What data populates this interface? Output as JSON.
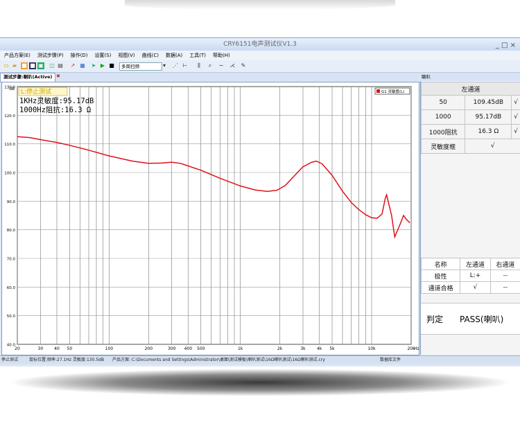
{
  "window": {
    "title": "CRY6151电声测试仪V1.3",
    "controls": "_ □ ×"
  },
  "menu": [
    "产品方案(E)",
    "测试步骤(P)",
    "操作(D)",
    "设置(S)",
    "视图(V)",
    "曲线(C)",
    "数据(A)",
    "工具(T)",
    "帮助(H)"
  ],
  "toolbar": {
    "select_value": "多周扫频"
  },
  "tab": {
    "label": "测试步骤:喇叭(Active)"
  },
  "chart": {
    "status_label": "L:停止测试",
    "sensitivity_text": "1KHz灵敏度:95.17dB",
    "impedance_text": "1000Hz阻抗:16.3 Ω",
    "legend_label": "G1 灵敏度(L)",
    "line_color": "#e0101a",
    "y_unit": "dB",
    "x_unit": "Hz"
  },
  "chart_data": {
    "type": "line",
    "x_scale": "log",
    "xlim": [
      20,
      20000
    ],
    "ylim": [
      40,
      130
    ],
    "y_ticks": [
      "130.0",
      "120.0",
      "110.0",
      "100.0",
      "90.0",
      "80.0",
      "70.0",
      "60.0",
      "50.0",
      "40.0"
    ],
    "x_ticks": [
      {
        "v": 20,
        "label": "20"
      },
      {
        "v": 30,
        "label": "30"
      },
      {
        "v": 40,
        "label": "40"
      },
      {
        "v": 50,
        "label": "50"
      },
      {
        "v": 100,
        "label": "100"
      },
      {
        "v": 200,
        "label": "200"
      },
      {
        "v": 300,
        "label": "300"
      },
      {
        "v": 400,
        "label": "400"
      },
      {
        "v": 500,
        "label": "500"
      },
      {
        "v": 1000,
        "label": "1k"
      },
      {
        "v": 2000,
        "label": "2k"
      },
      {
        "v": 3000,
        "label": "3k"
      },
      {
        "v": 4000,
        "label": "4k"
      },
      {
        "v": 5000,
        "label": "5k"
      },
      {
        "v": 10000,
        "label": "10k"
      },
      {
        "v": 20000,
        "label": "20k"
      }
    ],
    "series": [
      {
        "name": "G1 灵敏度(L)",
        "points": [
          [
            20,
            112.5
          ],
          [
            25,
            112.2
          ],
          [
            30,
            111.5
          ],
          [
            40,
            110.5
          ],
          [
            50,
            109.5
          ],
          [
            70,
            107.8
          ],
          [
            100,
            105.8
          ],
          [
            150,
            104
          ],
          [
            200,
            103.2
          ],
          [
            250,
            103.3
          ],
          [
            300,
            103.6
          ],
          [
            350,
            103.2
          ],
          [
            400,
            102.3
          ],
          [
            500,
            100.8
          ],
          [
            700,
            98
          ],
          [
            1000,
            95.3
          ],
          [
            1300,
            93.9
          ],
          [
            1600,
            93.4
          ],
          [
            1900,
            93.8
          ],
          [
            2200,
            95.5
          ],
          [
            2600,
            99
          ],
          [
            3000,
            102
          ],
          [
            3500,
            103.6
          ],
          [
            3800,
            104
          ],
          [
            4200,
            103
          ],
          [
            5000,
            99
          ],
          [
            6000,
            93.5
          ],
          [
            7000,
            89.5
          ],
          [
            8000,
            87
          ],
          [
            9000,
            85.3
          ],
          [
            10000,
            84.2
          ],
          [
            11000,
            84
          ],
          [
            12000,
            85.5
          ],
          [
            12700,
            91
          ],
          [
            13000,
            92.2
          ],
          [
            14200,
            85
          ],
          [
            15000,
            77.5
          ],
          [
            16500,
            82
          ],
          [
            17500,
            85
          ],
          [
            18500,
            83.5
          ],
          [
            19500,
            82.5
          ]
        ]
      }
    ]
  },
  "right_panel": {
    "header": "喇叭",
    "top_table": {
      "header": "左通道",
      "rows": [
        {
          "name": "50",
          "value": "109.45dB",
          "check": "√"
        },
        {
          "name": "1000",
          "value": "95.17dB",
          "check": "√"
        },
        {
          "name": "1000阻抗",
          "value": "16.3 Ω",
          "check": "√"
        },
        {
          "name": "灵敏度框",
          "value": "",
          "check": "√"
        }
      ]
    },
    "mid_table": {
      "headers": [
        "名称",
        "左通道",
        "右通道"
      ],
      "rows": [
        [
          "极性",
          "L:+",
          "--"
        ],
        [
          "通道合格",
          "√",
          "--"
        ]
      ]
    },
    "verdict": {
      "label": "判定",
      "value": "PASS(喇叭)"
    }
  },
  "status": {
    "left": "停止测试",
    "cursor": "鼠标位置:频率:27.1Hz 灵敏度:130.5dB",
    "scheme": "产品方案: C:\\Documents and Settings\\Administrator\\桌面\\测试模板\\喇叭测试\\16Ω喇叭测试\\16Ω喇叭测试.cry",
    "right": "数据库文件"
  }
}
